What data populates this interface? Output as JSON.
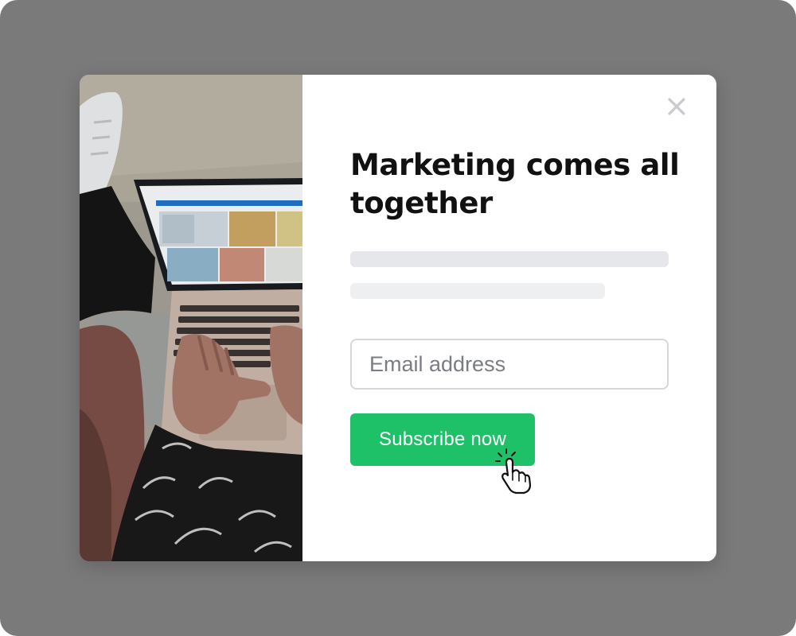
{
  "popup": {
    "headline": "Marketing comes all together",
    "email_placeholder": "Email address",
    "subscribe_label": "Subscribe now"
  },
  "colors": {
    "backdrop": "#7a7a7a",
    "accent": "#1ec167",
    "placeholder_bar_1": "#e6e7ea",
    "placeholder_bar_2": "#eeeff1"
  },
  "icons": {
    "close": "close-icon",
    "cursor": "hand-pointer-cursor-icon"
  }
}
